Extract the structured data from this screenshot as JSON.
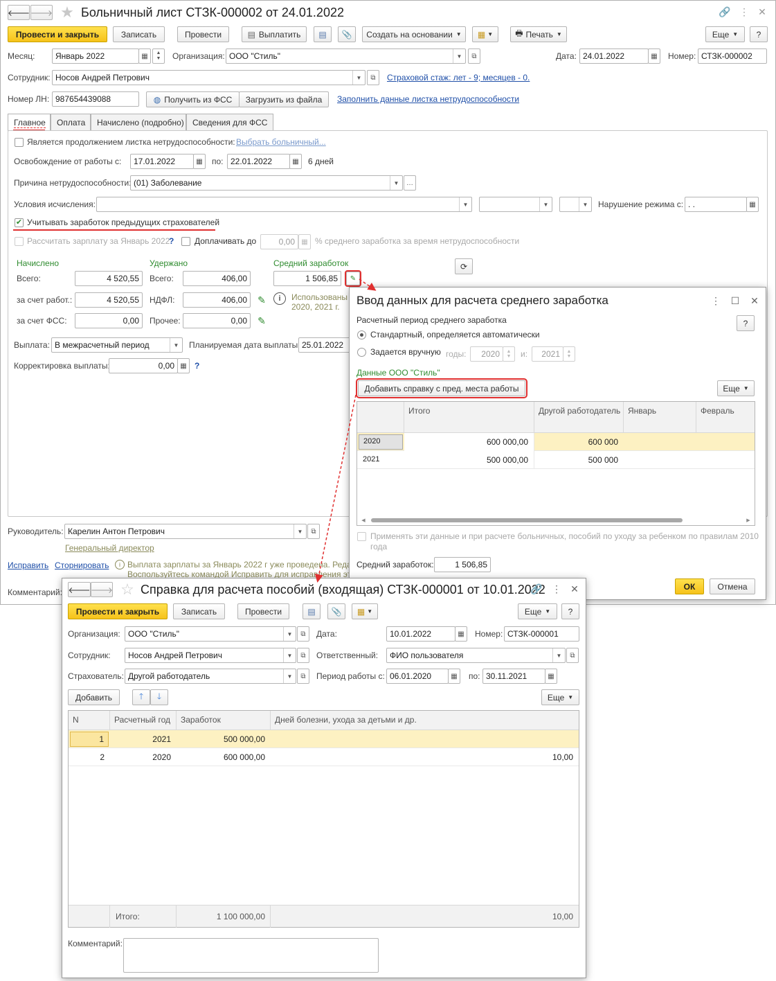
{
  "main": {
    "title": "Больничный лист СТЗК-000002 от 24.01.2022",
    "toolbar": {
      "post_close": "Провести и закрыть",
      "save": "Записать",
      "post": "Провести",
      "pay": "Выплатить",
      "create_based": "Создать на основании",
      "print": "Печать",
      "more": "Еще",
      "help": "?"
    },
    "month_label": "Месяц:",
    "month_value": "Январь 2022",
    "org_label": "Организация:",
    "org_value": "ООО \"Стиль\"",
    "date_label": "Дата:",
    "date_value": "24.01.2022",
    "number_label": "Номер:",
    "number_value": "СТЗК-000002",
    "employee_label": "Сотрудник:",
    "employee_value": "Носов Андрей Петрович",
    "insurance_link": "Страховой стаж: лет - 9; месяцев - 0.",
    "ln_label": "Номер ЛН:",
    "ln_value": "987654439088",
    "get_fss": "Получить из ФСС",
    "load_file": "Загрузить из файла",
    "fill_link": "Заполнить данные листка нетрудоспособности",
    "tabs": [
      "Главное",
      "Оплата",
      "Начислено (подробно)",
      "Сведения для ФСС"
    ],
    "continuation_label": "Является продолжением листка нетрудоспособности:",
    "choose_sick_link": "Выбрать больничный...",
    "release_label": "Освобождение от работы с:",
    "release_from": "17.01.2022",
    "release_to_label": "по:",
    "release_to": "22.01.2022",
    "days": "6 дней",
    "cause_label": "Причина нетрудоспособности:",
    "cause_value": "(01) Заболевание",
    "conditions_label": "Условия исчисления:",
    "violation_label": "Нарушение режима с:",
    "violation_value": " .  .",
    "consider_prev": "Учитывать заработок предыдущих страхователей",
    "calc_salary": "Рассчитать зарплату за Январь 2022",
    "q": "?",
    "pay_up_label": "Доплачивать до",
    "pay_up_value": "0,00",
    "pay_up_suffix": "% среднего заработка за время нетрудоспособности",
    "accrued_head": "Начислено",
    "withheld_head": "Удержано",
    "avg_head": "Средний заработок",
    "total_label": "Всего:",
    "accrued_total": "4 520,55",
    "withheld_total_label": "Всего:",
    "withheld_total": "406,00",
    "avg_value": "1 506,85",
    "employer_label": "за счет работ.:",
    "employer_value": "4 520,55",
    "ndfl_label": "НДФЛ:",
    "ndfl_value": "406,00",
    "used_text_1": "Использованы",
    "used_text_2": "2020,  2021 г.",
    "fss_label": "за счет ФСС:",
    "fss_value": "0,00",
    "other_label": "Прочее:",
    "other_value": "0,00",
    "payout_label": "Выплата:",
    "payout_value": "В межрасчетный период",
    "planned_label": "Планируемая дата выплаты:",
    "planned_value": "25.01.2022",
    "correction_label": "Корректировка выплаты:",
    "correction_value": "0,00",
    "manager_label": "Руководитель:",
    "manager_value": "Карелин Антон Петрович",
    "manager_position": "Генеральный директор",
    "fix_link": "Исправить",
    "reverse_link": "Сторнировать",
    "warning_1": "Выплата зарплаты за Январь 2022 г уже проведена. Редак",
    "warning_2": "Воспользуйтесь командой Исправить для исправления это",
    "comment_label": "Комментарий:"
  },
  "avg_dialog": {
    "title": "Ввод данных для расчета среднего заработка",
    "period_label": "Расчетный период среднего заработка",
    "help": "?",
    "radio_standard": "Стандартный, определяется автоматически",
    "radio_manual": "Задается вручную",
    "years_label": "годы:",
    "year1": "2020",
    "and_label": "и:",
    "year2": "2021",
    "org_data": "Данные ООО \"Стиль\"",
    "add_cert": "Добавить справку с пред. места работы",
    "more": "Еще",
    "columns": [
      "",
      "Итого",
      "Другой работодатель",
      "Январь",
      "Февраль"
    ],
    "rows": [
      {
        "year": "2020",
        "total": "600 000,00",
        "other": "600 000"
      },
      {
        "year": "2021",
        "total": "500 000,00",
        "other": "500 000"
      }
    ],
    "apply_text_1": "Применять эти данные и при расчете больничных, пособий по уходу за ребенком по правилам 2010",
    "apply_text_2": "года",
    "avg_label": "Средний заработок:",
    "avg_value": "1 506,85",
    "ok": "ОК",
    "cancel": "Отмена"
  },
  "cert": {
    "title": "Справка для расчета пособий (входящая) СТЗК-000001 от 10.01.2022",
    "toolbar": {
      "post_close": "Провести и закрыть",
      "save": "Записать",
      "post": "Провести",
      "more": "Еще",
      "help": "?"
    },
    "org_label": "Организация:",
    "org_value": "ООО \"Стиль\"",
    "date_label": "Дата:",
    "date_value": "10.01.2022",
    "number_label": "Номер:",
    "number_value": "СТЗК-000001",
    "employee_label": "Сотрудник:",
    "employee_value": "Носов Андрей Петрович",
    "responsible_label": "Ответственный:",
    "responsible_value": "ФИО пользователя",
    "insurer_label": "Страхователь:",
    "insurer_value": "Другой работодатель",
    "period_label": "Период работы с:",
    "period_from": "06.01.2020",
    "period_to_label": "по:",
    "period_to": "30.11.2021",
    "add": "Добавить",
    "more2": "Еще",
    "columns": [
      "N",
      "Расчетный год",
      "Заработок",
      "Дней болезни, ухода за детьми и др."
    ],
    "rows": [
      {
        "n": "1",
        "year": "2021",
        "earnings": "500 000,00",
        "days": ""
      },
      {
        "n": "2",
        "year": "2020",
        "earnings": "600 000,00",
        "days": "10,00"
      }
    ],
    "total_label": "Итого:",
    "total_earnings": "1 100 000,00",
    "total_days": "10,00",
    "comment_label": "Комментарий:"
  },
  "colors": {
    "accent_yellow": "#f6c21a",
    "link": "#1f4fa8",
    "green": "#2e8b2e",
    "red": "#e03030",
    "row_highlight": "#fdf1c2"
  }
}
